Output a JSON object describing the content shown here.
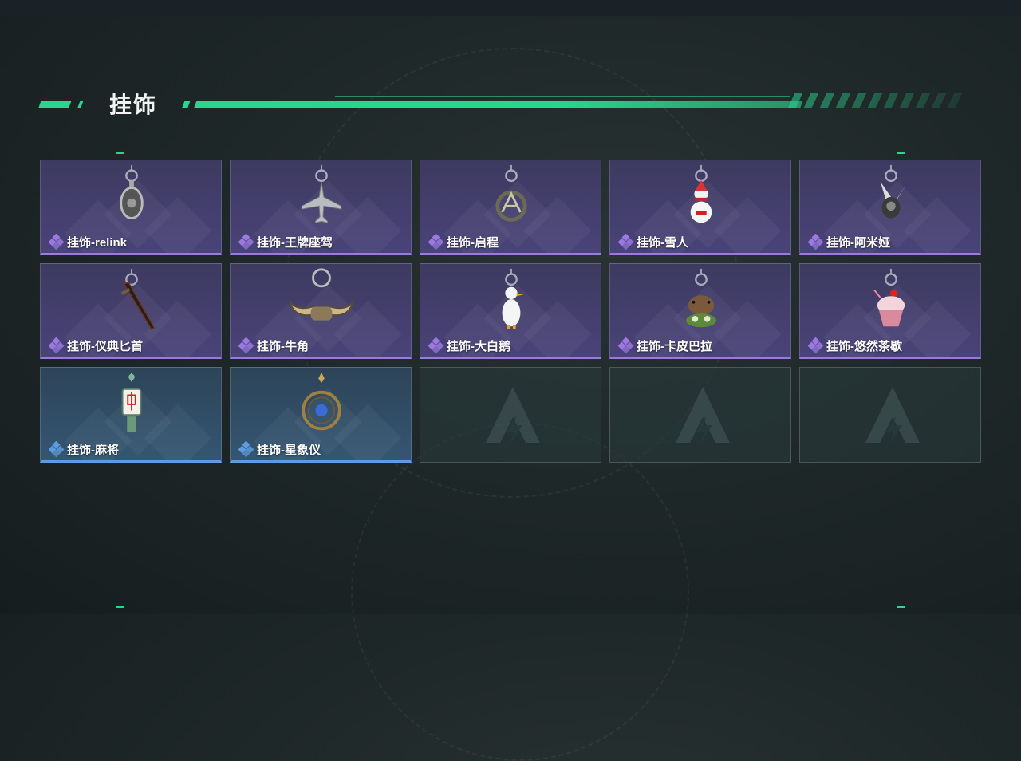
{
  "page": {
    "section_title": "挂饰",
    "accent_color": "#2bd58e"
  },
  "rarity_colors": {
    "epic": "#9b79e0",
    "rare": "#5f9be0"
  },
  "items": [
    {
      "name": "挂饰-relink",
      "rarity": "epic",
      "icon": "ornate-charm-icon"
    },
    {
      "name": "挂饰-王牌座驾",
      "rarity": "epic",
      "icon": "jet-plane-charm-icon"
    },
    {
      "name": "挂饰-启程",
      "rarity": "epic",
      "icon": "compass-ring-charm-icon"
    },
    {
      "name": "挂饰-雪人",
      "rarity": "epic",
      "icon": "snowman-charm-icon"
    },
    {
      "name": "挂饰-阿米娅",
      "rarity": "epic",
      "icon": "bunny-ears-charm-icon"
    },
    {
      "name": "挂饰-仪典匕首",
      "rarity": "epic",
      "icon": "dagger-charm-icon"
    },
    {
      "name": "挂饰-牛角",
      "rarity": "epic",
      "icon": "ox-horns-charm-icon"
    },
    {
      "name": "挂饰-大白鹅",
      "rarity": "epic",
      "icon": "white-goose-charm-icon"
    },
    {
      "name": "挂饰-卡皮巴拉",
      "rarity": "epic",
      "icon": "capybara-charm-icon"
    },
    {
      "name": "挂饰-悠然茶歇",
      "rarity": "epic",
      "icon": "cupcake-charm-icon"
    },
    {
      "name": "挂饰-麻将",
      "rarity": "rare",
      "icon": "mahjong-tile-charm-icon"
    },
    {
      "name": "挂饰-星象仪",
      "rarity": "rare",
      "icon": "astrolabe-charm-icon"
    }
  ],
  "empty_slots": 3
}
